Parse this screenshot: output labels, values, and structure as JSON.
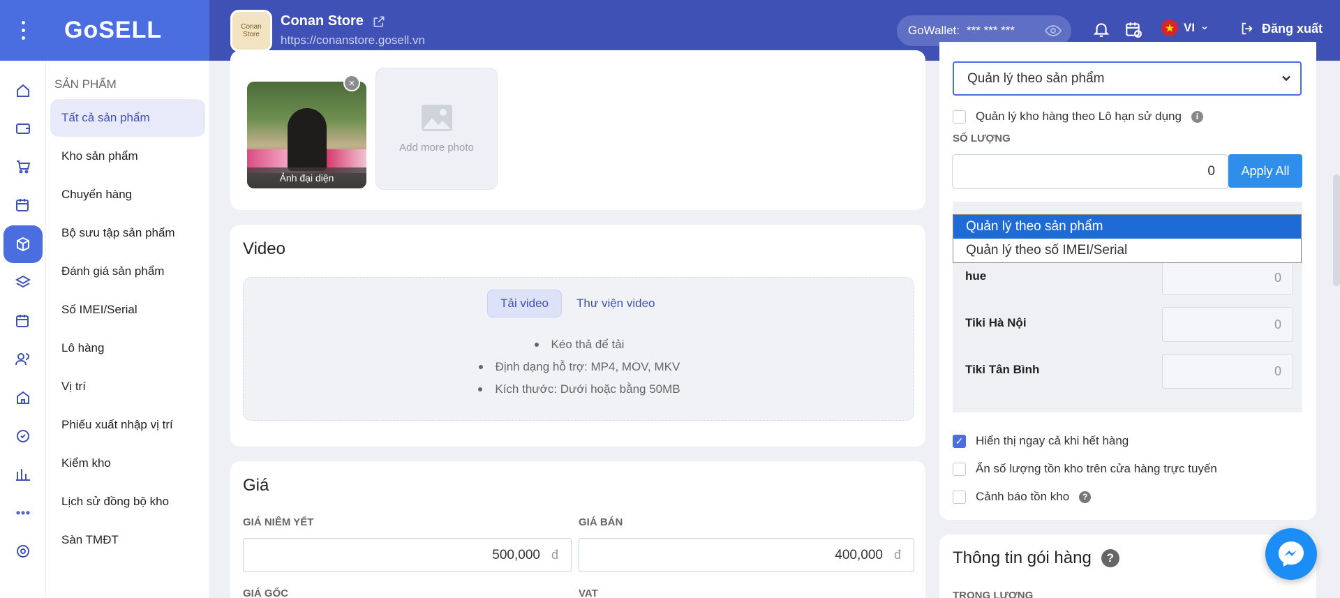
{
  "brand": {
    "logo": "GoSELL"
  },
  "store": {
    "name": "Conan Store",
    "url": "https://conanstore.gosell.vn",
    "avatar_text": "Conan Store"
  },
  "header": {
    "wallet_label": "GoWallet:",
    "wallet_value": "*** *** ***",
    "language": "VI",
    "logout": "Đăng xuất"
  },
  "rail": {
    "icons": [
      "home-icon",
      "wallet-icon",
      "cart-icon",
      "calendar-check-icon",
      "box-icon",
      "layers-icon",
      "calendar-edit-icon",
      "users-icon",
      "store-icon",
      "settings-badge-icon",
      "chart-icon",
      "more-icon",
      "gear-icon"
    ]
  },
  "sidebar": {
    "title": "SẢN PHẨM",
    "items": [
      {
        "label": "Tất cả sản phẩm",
        "active": true
      },
      {
        "label": "Kho sản phẩm"
      },
      {
        "label": "Chuyển hàng"
      },
      {
        "label": "Bộ sưu tập sản phẩm"
      },
      {
        "label": "Đánh giá sản phẩm"
      },
      {
        "label": "Số IMEI/Serial"
      },
      {
        "label": "Lô hàng"
      },
      {
        "label": "Vị trí"
      },
      {
        "label": "Phiếu xuất nhập vị trí"
      },
      {
        "label": "Kiểm kho"
      },
      {
        "label": "Lịch sử đồng bộ kho"
      },
      {
        "label": "Sàn TMĐT"
      }
    ]
  },
  "media": {
    "photo_caption": "Ảnh đại diện",
    "add_more": "Add more photo"
  },
  "video": {
    "title": "Video",
    "tabs": [
      {
        "label": "Tải video",
        "active": true
      },
      {
        "label": "Thư viện video"
      }
    ],
    "hints": [
      "Kéo thả để tải",
      "Định dạng hỗ trợ: MP4, MOV, MKV",
      "Kích thước: Dưới hoặc bằng 50MB"
    ]
  },
  "price": {
    "title": "Giá",
    "list_label": "GIÁ NIÊM YẾT",
    "list_value": "500,000",
    "sale_label": "GIÁ BÁN",
    "sale_value": "400,000",
    "currency": "đ",
    "cost_label": "GIÁ GỐC",
    "vat_label": "VAT"
  },
  "inventory": {
    "mode_selected": "Quản lý theo sản phẩm",
    "mode_options": [
      "Quản lý theo sản phẩm",
      "Quản lý theo số IMEI/Serial"
    ],
    "lot_label": "Quản lý kho hàng theo Lô hạn sử dụng",
    "qty_label": "SỐ LƯỢNG",
    "qty_value": "0",
    "apply_all": "Apply All",
    "branches": [
      {
        "name": "hue",
        "qty": "0"
      },
      {
        "name": "Tiki Hà Nội",
        "qty": "0"
      },
      {
        "name": "Tiki Tân Bình",
        "qty": "0"
      }
    ],
    "options": [
      {
        "label": "Hiển thị ngay cả khi hết hàng",
        "checked": true
      },
      {
        "label": "Ẩn số lượng tồn kho trên cửa hàng trực tuyến",
        "checked": false
      },
      {
        "label": "Cảnh báo tồn kho",
        "checked": false
      }
    ]
  },
  "package": {
    "title": "Thông tin gói hàng",
    "weight_label": "TRỌNG LƯỢNG"
  },
  "colors": {
    "primary": "#3f51b5",
    "brand": "#4a6ee0",
    "apply": "#2e8eea",
    "selected_option": "#1f6bd6"
  }
}
